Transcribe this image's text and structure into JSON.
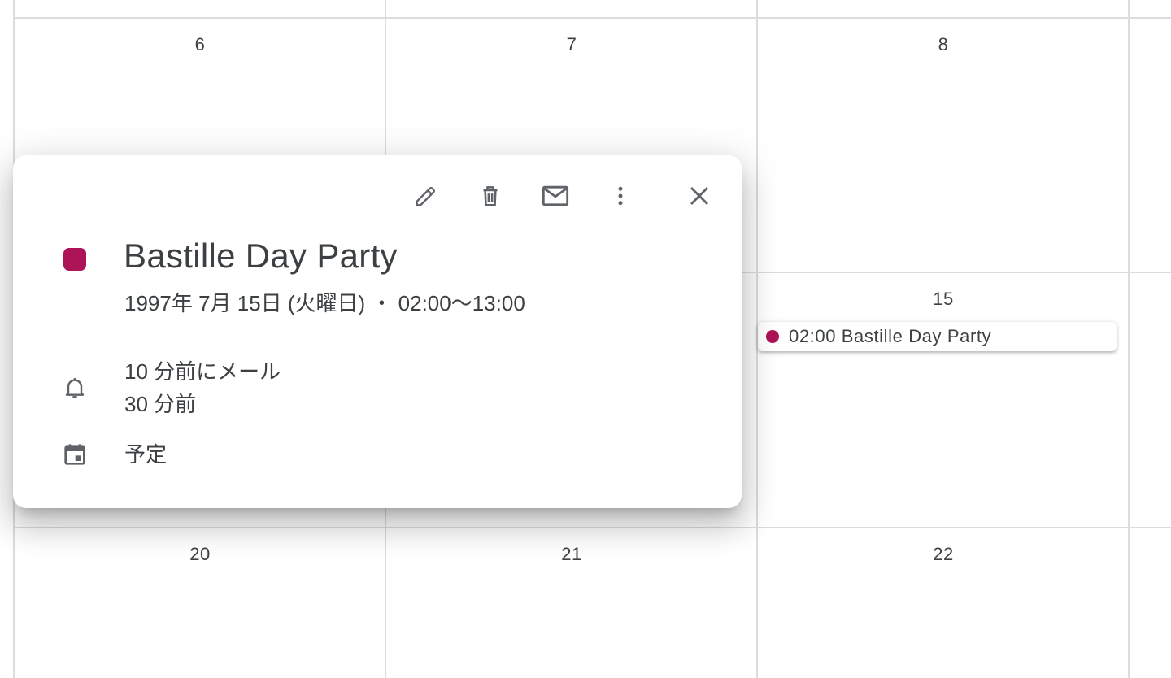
{
  "calendar": {
    "days": {
      "row1": [
        "6",
        "7",
        "8"
      ],
      "row2_col3": "15",
      "row3": [
        "20",
        "21",
        "22"
      ]
    },
    "event_chip": {
      "text": "02:00 Bastille Day Party",
      "color": "#ad1457"
    }
  },
  "popup": {
    "toolbar": {
      "edit_icon": "edit-icon",
      "delete_icon": "trash-icon",
      "email_icon": "email-icon",
      "more_icon": "more-vert-icon",
      "close_icon": "close-icon"
    },
    "event_color": "#ad1457",
    "title": "Bastille Day Party",
    "datetime": "1997年 7月 15日 (火曜日) ・ 02:00〜13:00",
    "notifications": [
      "10 分前にメール",
      "30 分前"
    ],
    "calendar_name": "予定"
  }
}
